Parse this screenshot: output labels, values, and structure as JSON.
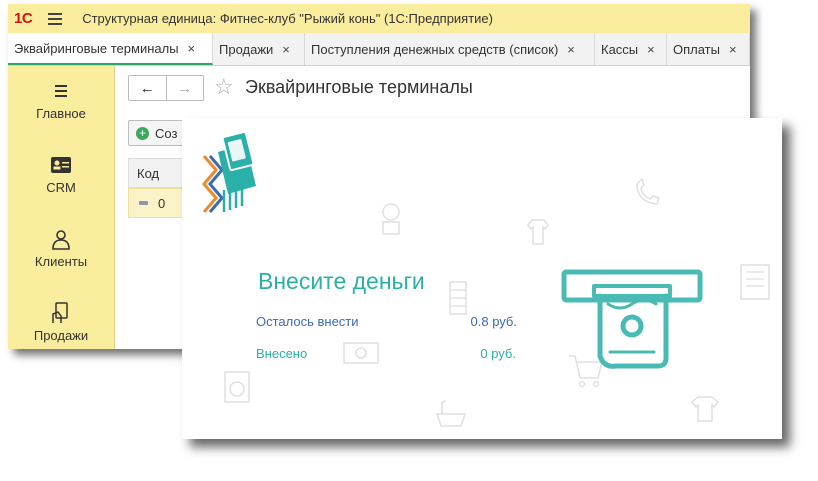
{
  "window": {
    "logo": "1С",
    "title": "Структурная единица: Фитнес-клуб \"Рыжий конь\"  (1С:Предприятие)"
  },
  "tabs": [
    {
      "label": "Эквайринговые терминалы",
      "close": "×"
    },
    {
      "label": "Продажи",
      "close": "×"
    },
    {
      "label": "Поступления денежных средств (список)",
      "close": "×"
    },
    {
      "label": "Кассы",
      "close": "×"
    },
    {
      "label": "Оплаты",
      "close": "×"
    }
  ],
  "sidebar": {
    "items": [
      {
        "label": "Главное",
        "icon": "menu-lines-icon"
      },
      {
        "label": "CRM",
        "icon": "id-card-icon"
      },
      {
        "label": "Клиенты",
        "icon": "person-icon"
      },
      {
        "label": "Продажи",
        "icon": "card-hand-icon"
      }
    ]
  },
  "form": {
    "back": "←",
    "forward": "→",
    "star": "☆",
    "title": "Эквайринговые терминалы",
    "create_label": "Соз",
    "column_code": "Код",
    "row_code": "0"
  },
  "payment": {
    "heading": "Внесите деньги",
    "remaining_label": "Осталось внести",
    "remaining_value": "0.8 руб.",
    "paid_label": "Внесено",
    "paid_value": "0 руб.",
    "accent_color": "#2ab0a8",
    "label_color": "#3e6ab0"
  }
}
